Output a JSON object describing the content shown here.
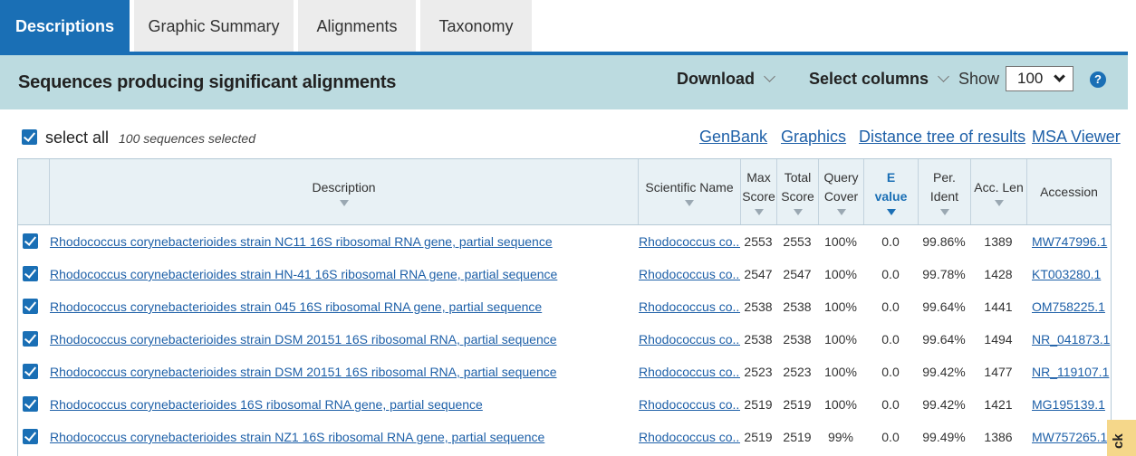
{
  "tabs": [
    {
      "label": "Descriptions",
      "active": true
    },
    {
      "label": "Graphic Summary",
      "active": false
    },
    {
      "label": "Alignments",
      "active": false
    },
    {
      "label": "Taxonomy",
      "active": false
    }
  ],
  "header": {
    "title": "Sequences producing significant alignments",
    "download_label": "Download",
    "select_columns_label": "Select columns",
    "show_label": "Show",
    "show_value": "100",
    "help_icon": "?"
  },
  "selection": {
    "select_all_label": "select all",
    "selected_count_text": "100 sequences selected"
  },
  "links": {
    "genbank": "GenBank",
    "graphics": "Graphics",
    "distance_tree": "Distance tree of results",
    "msa_viewer": "MSA Viewer"
  },
  "columns": {
    "description": "Description",
    "scientific_name": "Scientific Name",
    "max_score": [
      "Max",
      "Score"
    ],
    "total_score": [
      "Total",
      "Score"
    ],
    "query_cover": [
      "Query",
      "Cover"
    ],
    "e_value": [
      "E",
      "value"
    ],
    "per_ident": [
      "Per.",
      "Ident"
    ],
    "acc_len": "Acc. Len",
    "accession": "Accession"
  },
  "rows": [
    {
      "description": "Rhodococcus corynebacterioides strain NC11 16S ribosomal RNA gene, partial sequence",
      "scientific_name": "Rhodococcus co...",
      "max_score": "2553",
      "total_score": "2553",
      "query_cover": "100%",
      "e_value": "0.0",
      "per_ident": "99.86%",
      "acc_len": "1389",
      "accession": "MW747996.1"
    },
    {
      "description": "Rhodococcus corynebacterioides strain HN-41 16S ribosomal RNA gene, partial sequence",
      "scientific_name": "Rhodococcus co...",
      "max_score": "2547",
      "total_score": "2547",
      "query_cover": "100%",
      "e_value": "0.0",
      "per_ident": "99.78%",
      "acc_len": "1428",
      "accession": "KT003280.1"
    },
    {
      "description": "Rhodococcus corynebacterioides strain 045 16S ribosomal RNA gene, partial sequence",
      "scientific_name": "Rhodococcus co...",
      "max_score": "2538",
      "total_score": "2538",
      "query_cover": "100%",
      "e_value": "0.0",
      "per_ident": "99.64%",
      "acc_len": "1441",
      "accession": "OM758225.1"
    },
    {
      "description": "Rhodococcus corynebacterioides strain DSM 20151 16S ribosomal RNA, partial sequence",
      "scientific_name": "Rhodococcus co...",
      "max_score": "2538",
      "total_score": "2538",
      "query_cover": "100%",
      "e_value": "0.0",
      "per_ident": "99.64%",
      "acc_len": "1494",
      "accession": "NR_041873.1"
    },
    {
      "description": "Rhodococcus corynebacterioides strain DSM 20151 16S ribosomal RNA, partial sequence",
      "scientific_name": "Rhodococcus co...",
      "max_score": "2523",
      "total_score": "2523",
      "query_cover": "100%",
      "e_value": "0.0",
      "per_ident": "99.42%",
      "acc_len": "1477",
      "accession": "NR_119107.1"
    },
    {
      "description": "Rhodococcus corynebacterioides 16S ribosomal RNA gene, partial sequence",
      "scientific_name": "Rhodococcus co...",
      "max_score": "2519",
      "total_score": "2519",
      "query_cover": "100%",
      "e_value": "0.0",
      "per_ident": "99.42%",
      "acc_len": "1421",
      "accession": "MG195139.1"
    },
    {
      "description": "Rhodococcus corynebacterioides strain NZ1 16S ribosomal RNA gene, partial sequence",
      "scientific_name": "Rhodococcus co...",
      "max_score": "2519",
      "total_score": "2519",
      "query_cover": "99%",
      "e_value": "0.0",
      "per_ident": "99.49%",
      "acc_len": "1386",
      "accession": "MW757265.1"
    }
  ],
  "feedback_label": "ck",
  "colors": {
    "accent": "#1a6fb5",
    "band": "#bcdbe0",
    "link": "#1e60a8"
  }
}
